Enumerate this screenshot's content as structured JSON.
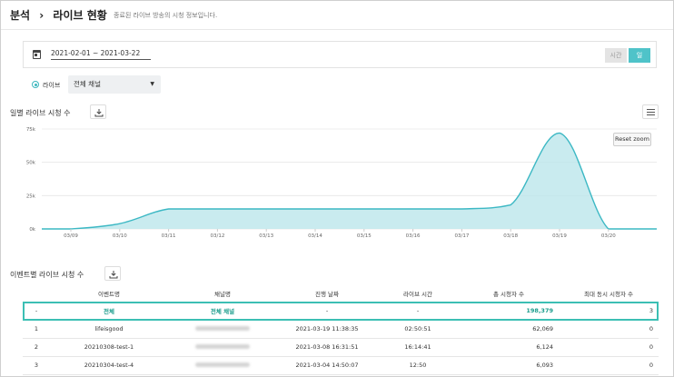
{
  "header": {
    "section": "분석",
    "separator": "›",
    "title": "라이브 현황",
    "description": "종료된 라이브 방송의 시청 정보입니다."
  },
  "filter": {
    "date_range": "2021-02-01 ~ 2021-03-22",
    "unit_time": "시간",
    "unit_day": "일"
  },
  "live_filter": {
    "radio_label": "라이브",
    "channel_select": "전체 채널"
  },
  "daily_section": {
    "title": "일별 라이브 시청 수",
    "reset_zoom": "Reset zoom"
  },
  "chart_data": {
    "type": "area",
    "categories": [
      "03/09",
      "03/10",
      "03/11",
      "03/12",
      "03/13",
      "03/14",
      "03/15",
      "03/16",
      "03/17",
      "03/18",
      "03/19",
      "03/20"
    ],
    "values": [
      0,
      4000,
      15000,
      15000,
      15000,
      15000,
      15000,
      15000,
      15000,
      18000,
      72000,
      0
    ],
    "ylim": [
      0,
      75000
    ],
    "yticks": [
      0,
      25000,
      50000,
      75000
    ],
    "ytick_labels": [
      "0k",
      "25k",
      "50k",
      "75k"
    ],
    "title": "",
    "xlabel": "",
    "ylabel": "",
    "grid": "horizontal",
    "colors": {
      "line": "#3cb8c4",
      "fill": "#bfe8ec"
    }
  },
  "event_section": {
    "title": "이벤트별 라이브 시청 수"
  },
  "table": {
    "columns": [
      "",
      "이벤트명",
      "채널명",
      "진행 날짜",
      "라이브 시간",
      "총 시청자 수",
      "최대 동시 시청자 수"
    ],
    "total_row": {
      "index": "-",
      "event": "전체",
      "channel": "전체 채널",
      "date": "-",
      "duration": "-",
      "total_viewers": "198,379",
      "max_concurrent": "3"
    },
    "rows": [
      {
        "index": "1",
        "event": "lifeisgood",
        "date": "2021-03-19 11:38:35",
        "duration": "02:50:51",
        "total_viewers": "62,069",
        "max_concurrent": "0"
      },
      {
        "index": "2",
        "event": "20210308-test-1",
        "date": "2021-03-08 16:31:51",
        "duration": "16:14:41",
        "total_viewers": "6,124",
        "max_concurrent": "0"
      },
      {
        "index": "3",
        "event": "20210304-test-4",
        "date": "2021-03-04 14:50:07",
        "duration": "12:50",
        "total_viewers": "6,093",
        "max_concurrent": "0"
      }
    ]
  },
  "icons": {
    "calendar": "calendar-icon",
    "download": "download-icon",
    "menu": "hamburger-menu-icon",
    "dropdown": "caret-down-icon"
  }
}
